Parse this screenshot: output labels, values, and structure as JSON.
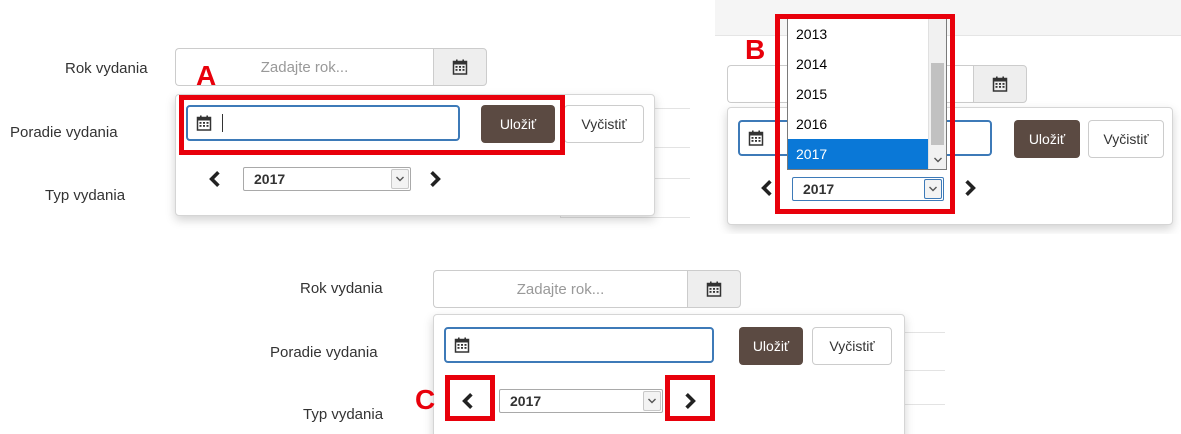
{
  "form": {
    "year_label": "Rok vydania",
    "order_label": "Poradie vydania",
    "type_label": "Typ vydania",
    "year_placeholder": "Zadajte rok..."
  },
  "picker": {
    "save_label": "Uložiť",
    "clear_label": "Vyčistiť",
    "year_value": "2017"
  },
  "dropdown": {
    "options": [
      "2013",
      "2014",
      "2015",
      "2016",
      "2017"
    ],
    "selected": "2017"
  },
  "callouts": {
    "a": "A",
    "b": "B",
    "c": "C"
  },
  "icons": {
    "calendar": "calendar-icon",
    "prev": "chevron-left-icon",
    "next": "chevron-right-icon",
    "dropdown": "chevron-down-icon"
  },
  "colors": {
    "highlight": "#e8000b",
    "save_button": "#5b4a42",
    "focus_border": "#3d7ab8",
    "selected_option": "#0a78d7"
  }
}
